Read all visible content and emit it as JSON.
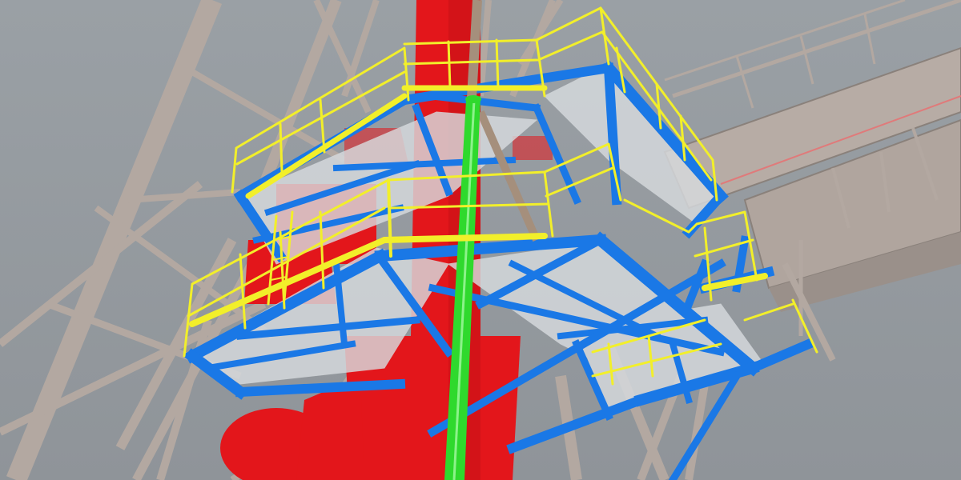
{
  "scene": {
    "colors": {
      "background_top": "#9aa0a5",
      "background_bottom": "#8f9499",
      "truss": "#b3a8a1",
      "truss_dark": "#8a817b",
      "platform_steel": "#1a78e6",
      "railing": "#f2ef2a",
      "column": "#e3161b",
      "column_shadow": "#b50f13",
      "pipe": "#2fd92d",
      "pipe_highlight": "#8cf28a",
      "deck": "#d7dbde",
      "cable": "#a58f7c"
    }
  }
}
